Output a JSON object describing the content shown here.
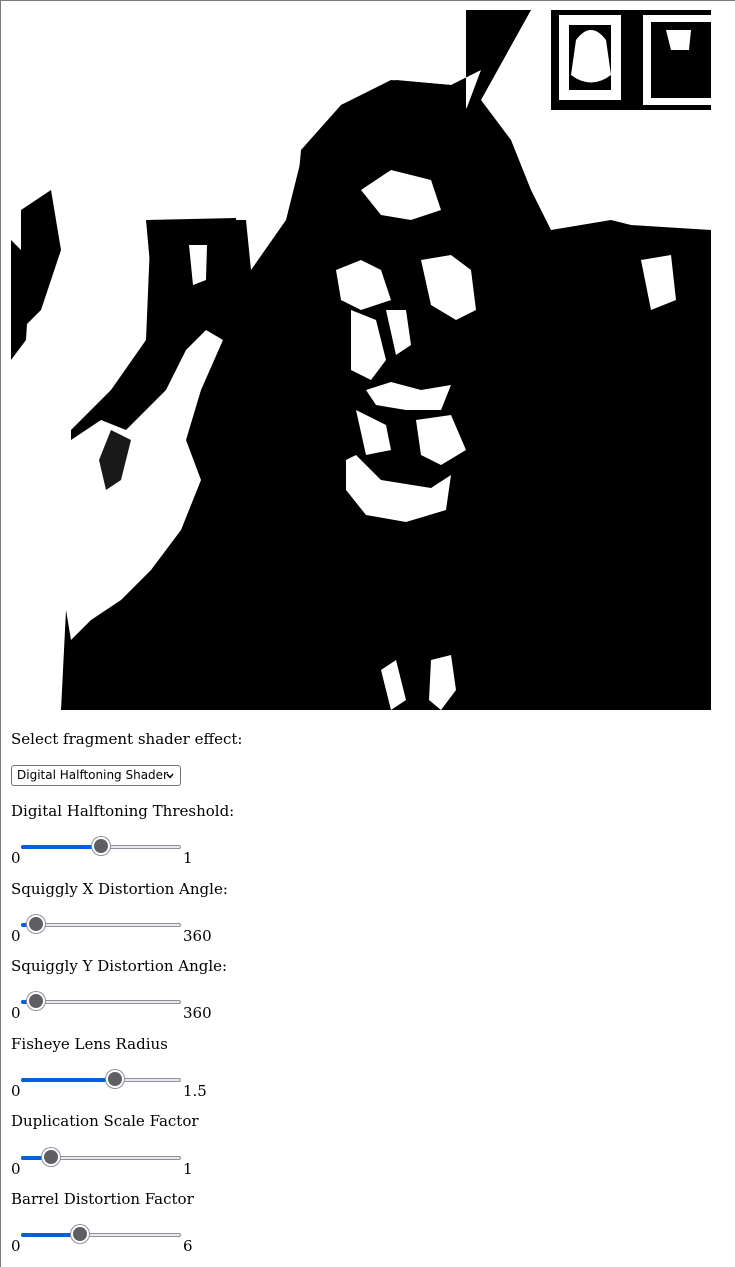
{
  "shader_select": {
    "label": "Select fragment shader effect:",
    "selected": "Digital Halftoning Shader"
  },
  "sliders": [
    {
      "label": "Digital Halftoning Threshold:",
      "min": "0",
      "max": "1",
      "value": 0.5
    },
    {
      "label": "Squiggly X Distortion Angle:",
      "min": "0",
      "max": "360",
      "value": 14
    },
    {
      "label": "Squiggly Y Distortion Angle:",
      "min": "0",
      "max": "360",
      "value": 16
    },
    {
      "label": "Fisheye Lens Radius",
      "min": "0",
      "max": "1.5",
      "value": 0.9
    },
    {
      "label": "Duplication Scale Factor",
      "min": "0",
      "max": "1",
      "value": 0.15
    },
    {
      "label": "Barrel Distortion Factor",
      "min": "0",
      "max": "6",
      "value": 2.1
    }
  ],
  "colors": {
    "accent": "#0060df",
    "thumb": "#5e5e64"
  }
}
